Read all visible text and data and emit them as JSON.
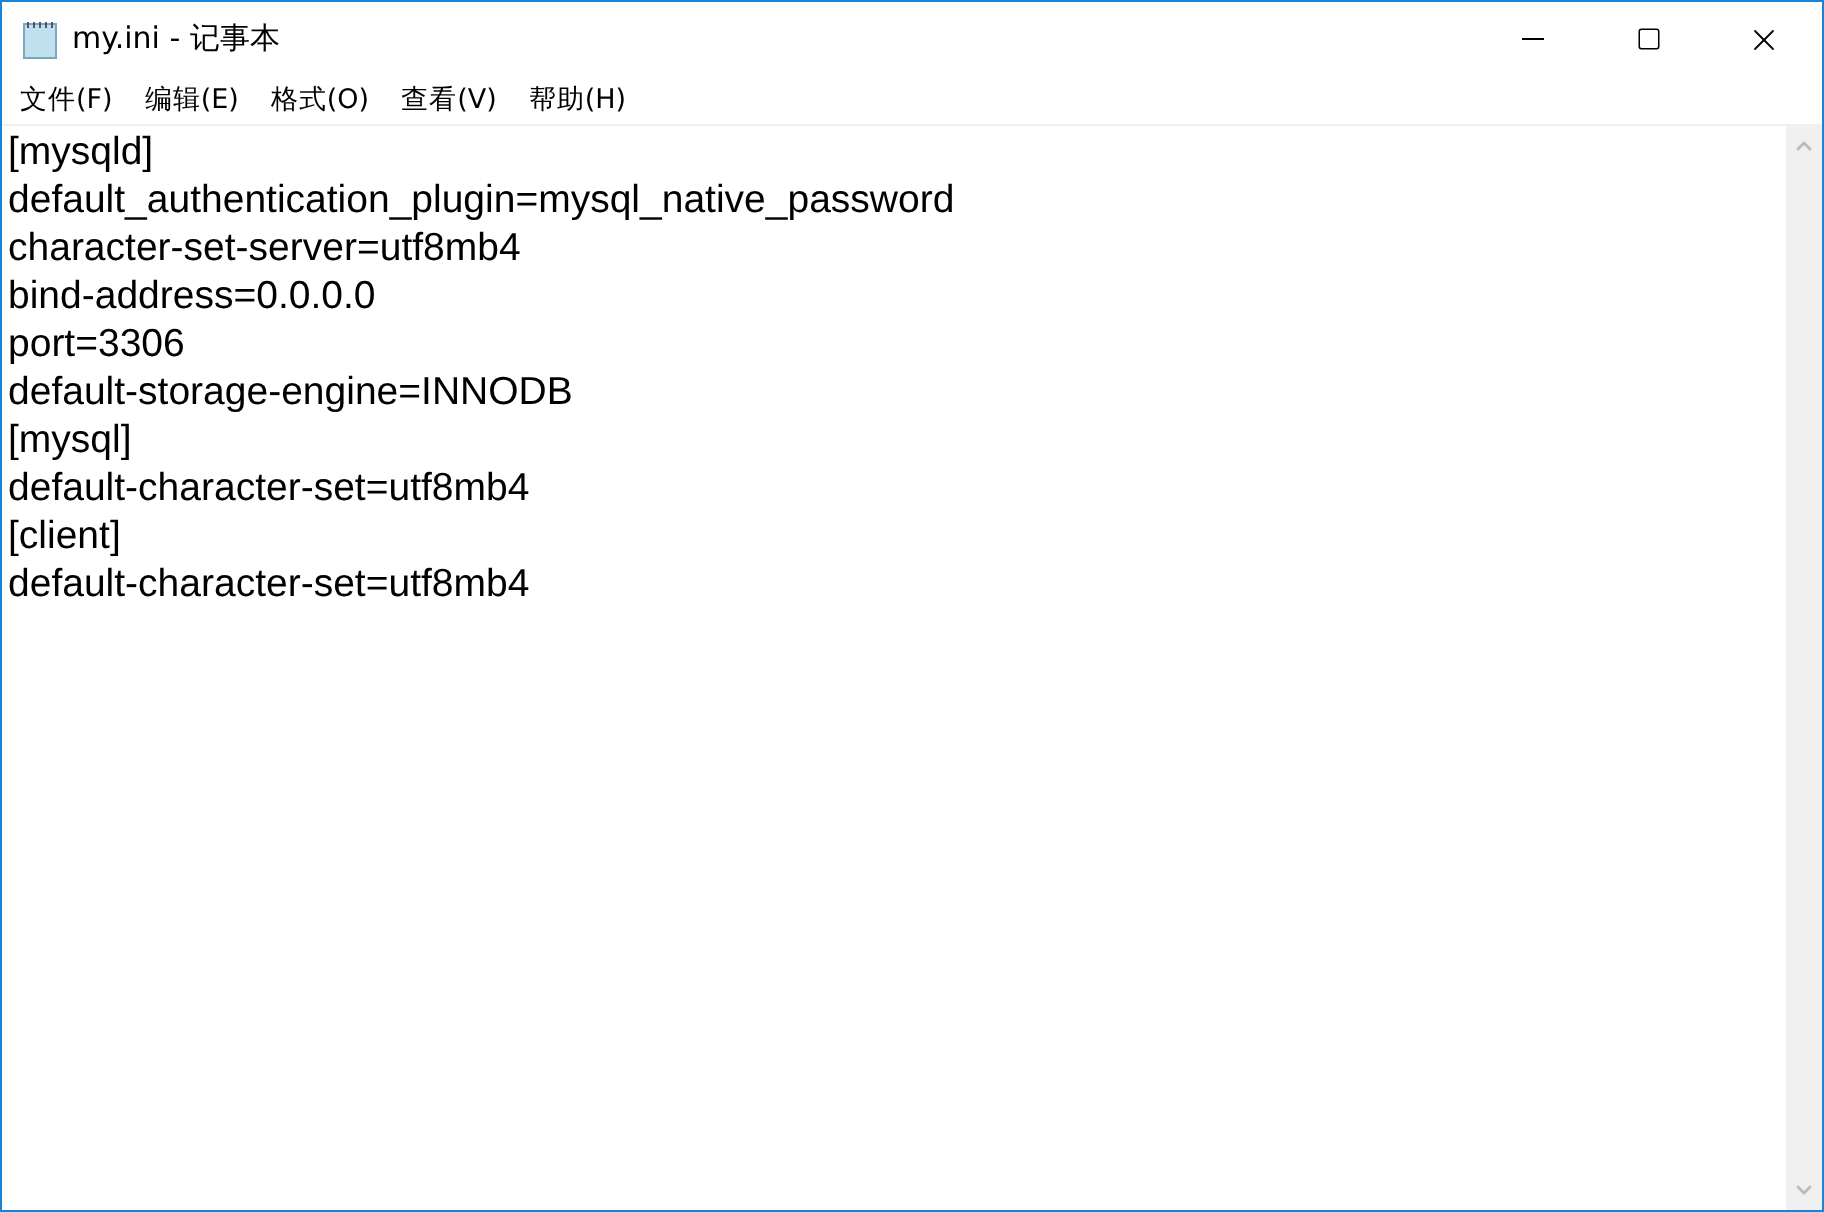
{
  "window": {
    "title": "my.ini - 记事本"
  },
  "menu": [
    "文件(F)",
    "编辑(E)",
    "格式(O)",
    "查看(V)",
    "帮助(H)"
  ],
  "editor": {
    "lines": [
      "[mysqld]",
      "default_authentication_plugin=mysql_native_password",
      "character-set-server=utf8mb4",
      "bind-address=0.0.0.0",
      "port=3306",
      "default-storage-engine=INNODB",
      "[mysql]",
      "default-character-set=utf8mb4",
      "[client]",
      "default-character-set=utf8mb4"
    ]
  }
}
